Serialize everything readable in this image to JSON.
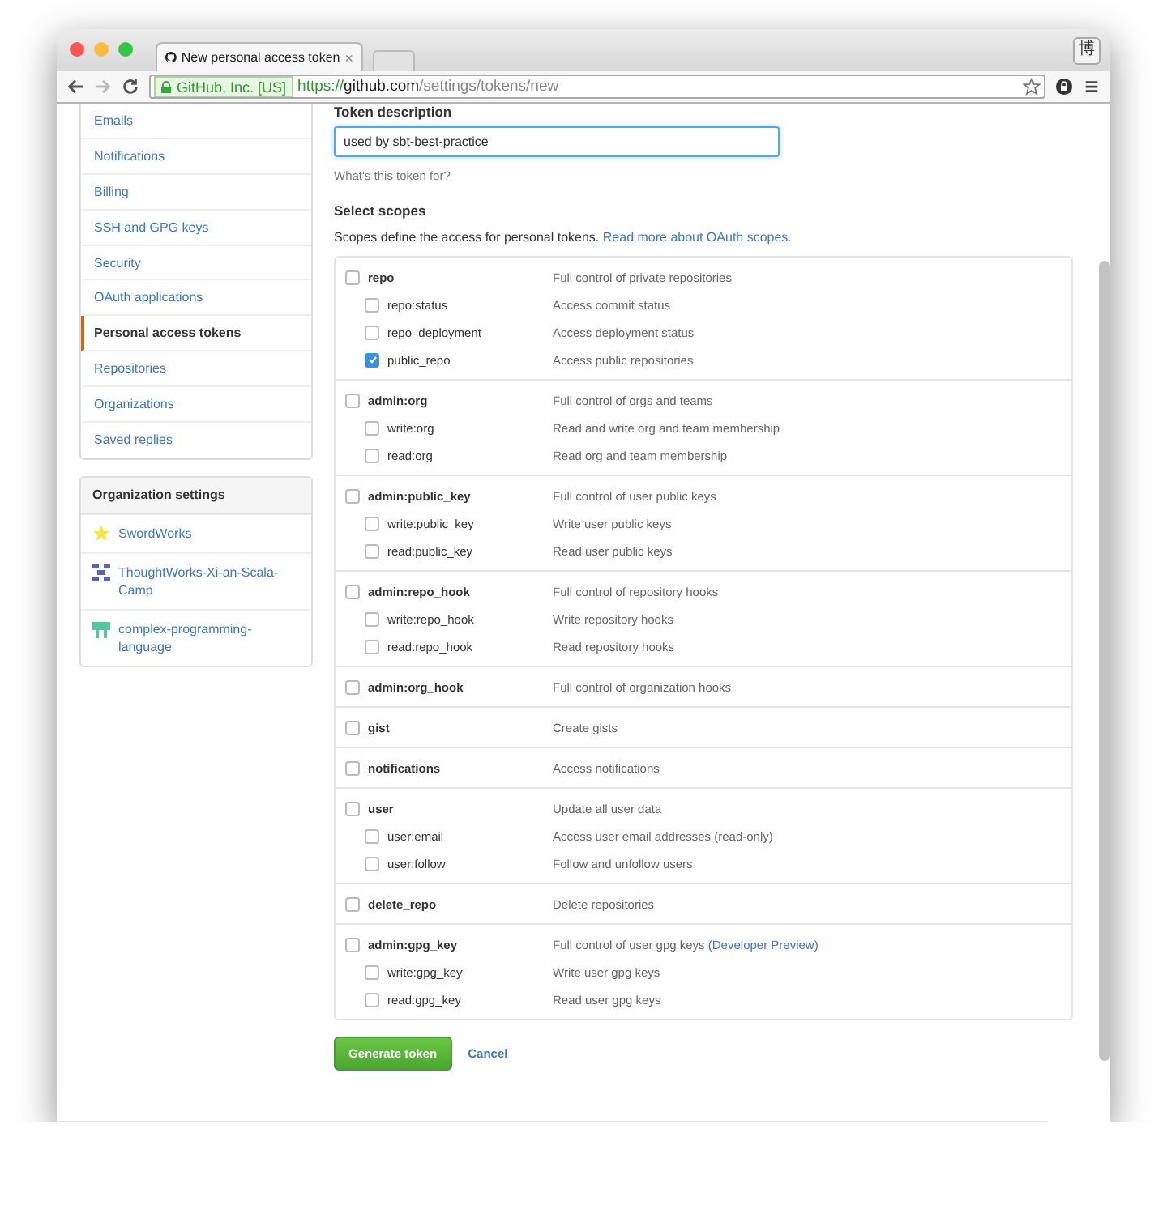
{
  "browser": {
    "tab": {
      "title": "New personal access token",
      "close": "×"
    },
    "profile_button": "博",
    "forward_disabled": true,
    "security_badge": "GitHub, Inc. [US]",
    "url": {
      "scheme": "https://",
      "host": "github.com",
      "path": "/settings/tokens/new"
    }
  },
  "sidebar": {
    "items": [
      {
        "label": "Emails",
        "selected": false
      },
      {
        "label": "Notifications",
        "selected": false
      },
      {
        "label": "Billing",
        "selected": false
      },
      {
        "label": "SSH and GPG keys",
        "selected": false
      },
      {
        "label": "Security",
        "selected": false
      },
      {
        "label": "OAuth applications",
        "selected": false
      },
      {
        "label": "Personal access tokens",
        "selected": true
      },
      {
        "label": "Repositories",
        "selected": false
      },
      {
        "label": "Organizations",
        "selected": false
      },
      {
        "label": "Saved replies",
        "selected": false
      }
    ],
    "org_section": {
      "title": "Organization settings",
      "items": [
        {
          "name": "SwordWorks",
          "color": "#f5e642"
        },
        {
          "name": "ThoughtWorks-Xi-an-Scala-Camp",
          "color": "#5b63b7"
        },
        {
          "name": "complex-programming-language",
          "color": "#52c7a0"
        }
      ]
    }
  },
  "form": {
    "label": "Token description",
    "value": "used by sbt-best-practice",
    "hint": "What's this token for?",
    "scopes_heading": "Select scopes",
    "scopes_intro": "Scopes define the access for personal tokens.",
    "scopes_link": "Read more about OAuth scopes.",
    "scope_groups": [
      {
        "name": "repo",
        "description": "Full control of private repositories",
        "checked": false,
        "children": [
          {
            "name": "repo:status",
            "description": "Access commit status",
            "checked": false
          },
          {
            "name": "repo_deployment",
            "description": "Access deployment status",
            "checked": false
          },
          {
            "name": "public_repo",
            "description": "Access public repositories",
            "checked": true
          }
        ]
      },
      {
        "name": "admin:org",
        "description": "Full control of orgs and teams",
        "checked": false,
        "children": [
          {
            "name": "write:org",
            "description": "Read and write org and team membership",
            "checked": false
          },
          {
            "name": "read:org",
            "description": "Read org and team membership",
            "checked": false
          }
        ]
      },
      {
        "name": "admin:public_key",
        "description": "Full control of user public keys",
        "checked": false,
        "children": [
          {
            "name": "write:public_key",
            "description": "Write user public keys",
            "checked": false
          },
          {
            "name": "read:public_key",
            "description": "Read user public keys",
            "checked": false
          }
        ]
      },
      {
        "name": "admin:repo_hook",
        "description": "Full control of repository hooks",
        "checked": false,
        "children": [
          {
            "name": "write:repo_hook",
            "description": "Write repository hooks",
            "checked": false
          },
          {
            "name": "read:repo_hook",
            "description": "Read repository hooks",
            "checked": false
          }
        ]
      },
      {
        "name": "admin:org_hook",
        "description": "Full control of organization hooks",
        "checked": false
      },
      {
        "name": "gist",
        "description": "Create gists",
        "checked": false
      },
      {
        "name": "notifications",
        "description": "Access notifications",
        "checked": false
      },
      {
        "name": "user",
        "description": "Update all user data",
        "checked": false,
        "children": [
          {
            "name": "user:email",
            "description": "Access user email addresses (read-only)",
            "checked": false
          },
          {
            "name": "user:follow",
            "description": "Follow and unfollow users",
            "checked": false
          }
        ]
      },
      {
        "name": "delete_repo",
        "description": "Delete repositories",
        "checked": false
      },
      {
        "name": "admin:gpg_key",
        "description": "Full control of user gpg keys",
        "link": "(Developer Preview)",
        "checked": false,
        "children": [
          {
            "name": "write:gpg_key",
            "description": "Write user gpg keys",
            "checked": false
          },
          {
            "name": "read:gpg_key",
            "description": "Read user gpg keys",
            "checked": false
          }
        ]
      }
    ],
    "submit": "Generate token",
    "cancel": "Cancel"
  }
}
